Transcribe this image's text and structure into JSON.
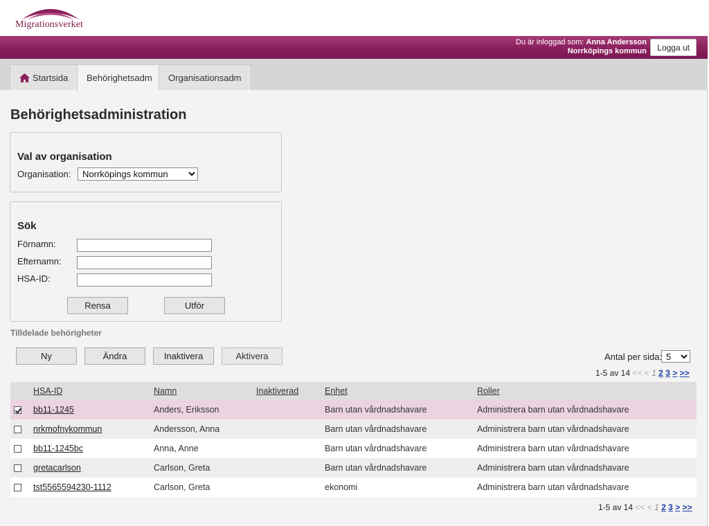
{
  "brand": {
    "name": "Migrationsverket",
    "color": "#8a1f5c"
  },
  "userbar": {
    "logged_in_label": "Du är inloggad som:",
    "user_name": "Anna Andersson",
    "organisation": "Norrköpings kommun",
    "logout_label": "Logga ut"
  },
  "tabs": [
    {
      "label": "Startsida",
      "icon": "home-icon",
      "active": false
    },
    {
      "label": "Behörighetsadm",
      "active": true
    },
    {
      "label": "Organisationsadm",
      "active": false
    }
  ],
  "page_title": "Behörighetsadministration",
  "org_panel": {
    "heading": "Val av organisation",
    "label": "Organisation:",
    "selected": "Norrköpings kommun"
  },
  "search_panel": {
    "heading": "Sök",
    "fields": [
      {
        "label": "Förnamn:",
        "value": ""
      },
      {
        "label": "Efternamn:",
        "value": ""
      },
      {
        "label": "HSA-ID:",
        "value": ""
      }
    ],
    "reset_label": "Rensa",
    "submit_label": "Utför"
  },
  "assigned": {
    "heading": "Tilldelade behörigheter",
    "actions": [
      "Ny",
      "Ändra",
      "Inaktivera",
      "Aktivera"
    ],
    "per_page_label": "Antal per sida:",
    "per_page_value": "5",
    "pager": {
      "summary": "1-5 av 14",
      "first": "<<",
      "prev": "<",
      "current": "1",
      "pages": [
        "2",
        "3"
      ],
      "next": ">",
      "last": ">>"
    },
    "columns": [
      "HSA-ID",
      "Namn",
      "Inaktiverad",
      "Enhet",
      "Roller"
    ],
    "rows": [
      {
        "checked": true,
        "hsa_id": "bb11-1245",
        "namn": "Anders, Eriksson",
        "inaktiverad": "",
        "enhet": "Barn utan vårdnadshavare",
        "roller": "Administrera barn utan vårdnadshavare"
      },
      {
        "checked": false,
        "hsa_id": "nrkmofnykommun",
        "namn": "Andersson, Anna",
        "inaktiverad": "",
        "enhet": "Barn utan vårdnadshavare",
        "roller": "Administrera barn utan vårdnadshavare"
      },
      {
        "checked": false,
        "hsa_id": "bb11-1245bc",
        "namn": "Anna, Anne",
        "inaktiverad": "",
        "enhet": "Barn utan vårdnadshavare",
        "roller": "Administrera barn utan vårdnadshavare"
      },
      {
        "checked": false,
        "hsa_id": "gretacarlson",
        "namn": "Carlson, Greta",
        "inaktiverad": "",
        "enhet": "Barn utan vårdnadshavare",
        "roller": "Administrera barn utan vårdnadshavare"
      },
      {
        "checked": false,
        "hsa_id": "tst5565594230-1112",
        "namn": "Carlson, Greta",
        "inaktiverad": "",
        "enhet": "ekonomi",
        "roller": "Administrera barn utan vårdnadshavare"
      }
    ]
  }
}
